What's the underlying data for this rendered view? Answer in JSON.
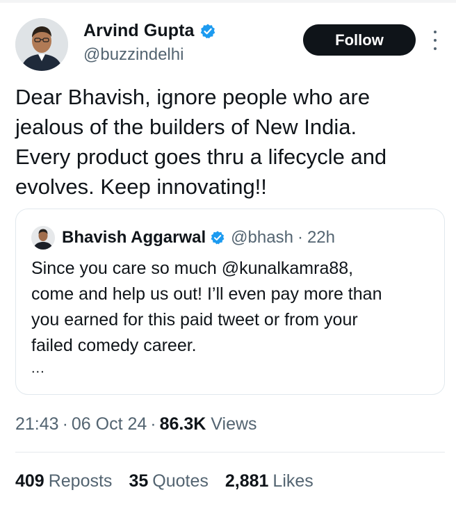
{
  "tweet": {
    "author": {
      "name": "Arvind Gupta",
      "handle": "@buzzindelhi",
      "verified": true,
      "avatar_icon": "person-avatar"
    },
    "follow_label": "Follow",
    "more_icon": "vertical-ellipsis-icon",
    "text_lines": [
      "Dear Bhavish, ignore people who are",
      "jealous of the builders of New India.",
      "Every product goes thru a lifecycle and",
      "evolves. Keep innovating!!"
    ],
    "quoted": {
      "name": "Bhavish Aggarwal",
      "handle": "@bhash",
      "separator": "·",
      "time": "22h",
      "verified": true,
      "text_lines": [
        "Since you care so much @kunalkamra88,",
        "come and help us out! I’ll even pay more than",
        "you earned for this paid tweet or from your",
        "failed comedy career."
      ],
      "truncation": "..."
    },
    "meta": {
      "time": "21:43",
      "separator": "·",
      "date": "06 Oct 24",
      "views_count": "86.3K",
      "views_label": "Views"
    },
    "stats": [
      {
        "count": "409",
        "label": "Reposts"
      },
      {
        "count": "35",
        "label": "Quotes"
      },
      {
        "count": "2,881",
        "label": "Likes"
      }
    ]
  },
  "colors": {
    "text_primary": "#0f1419",
    "text_secondary": "#536471",
    "verified_blue": "#1d9bf0",
    "follow_bg": "#0f1419",
    "border": "#e1e8ed"
  }
}
